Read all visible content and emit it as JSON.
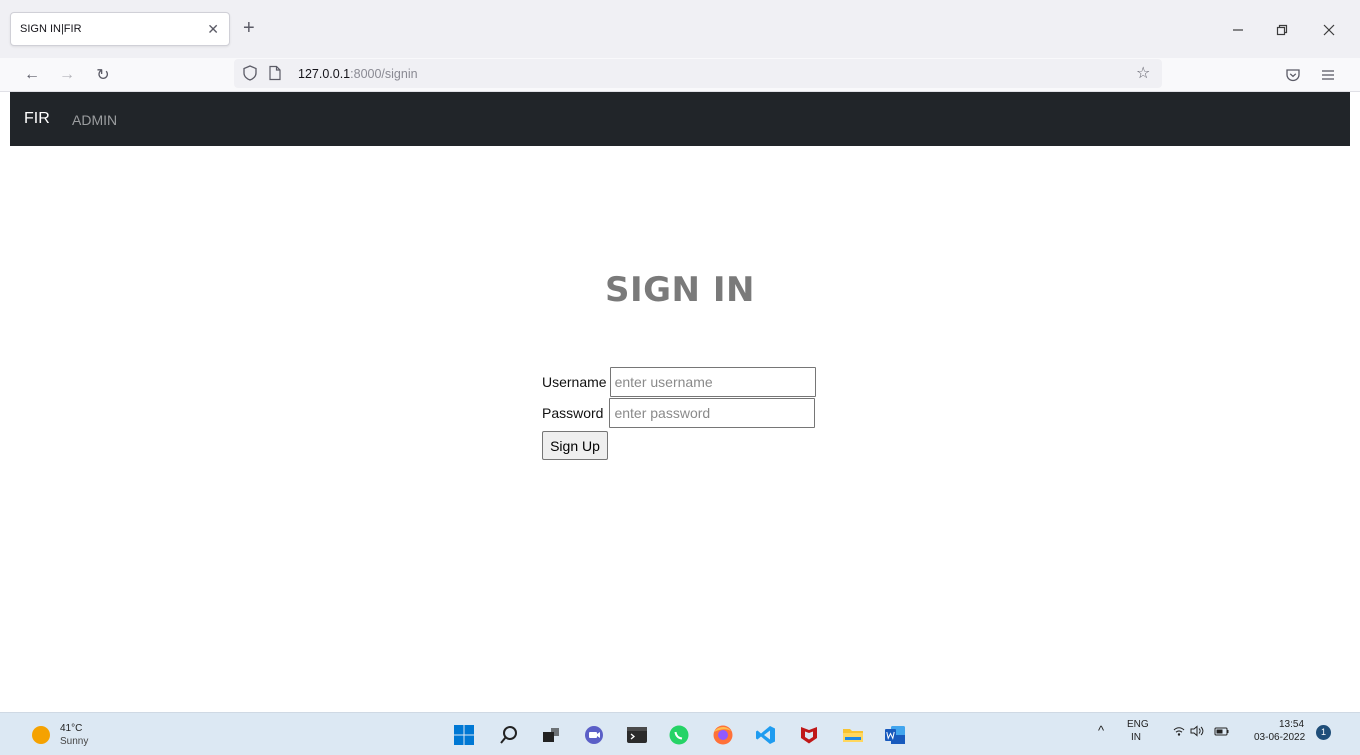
{
  "browser": {
    "tab_title": "SIGN IN|FIR",
    "url_host": "127.0.0.1",
    "url_path": ":8000/signin"
  },
  "app": {
    "brand": "FIR",
    "nav_admin": "ADMIN"
  },
  "signin": {
    "heading": "SIGN IN",
    "username_label": "Username",
    "username_placeholder": "enter username",
    "password_label": "Password",
    "password_placeholder": "enter password",
    "submit_label": "Sign Up"
  },
  "taskbar": {
    "weather_temp": "41°C",
    "weather_desc": "Sunny",
    "lang_top": "ENG",
    "lang_bottom": "IN",
    "time": "13:54",
    "date": "03-06-2022",
    "notification_count": "1"
  },
  "colors": {
    "app_nav_bg": "#212529",
    "heading": "#7a7a7a",
    "taskbar_bg": "#dce8f3"
  }
}
